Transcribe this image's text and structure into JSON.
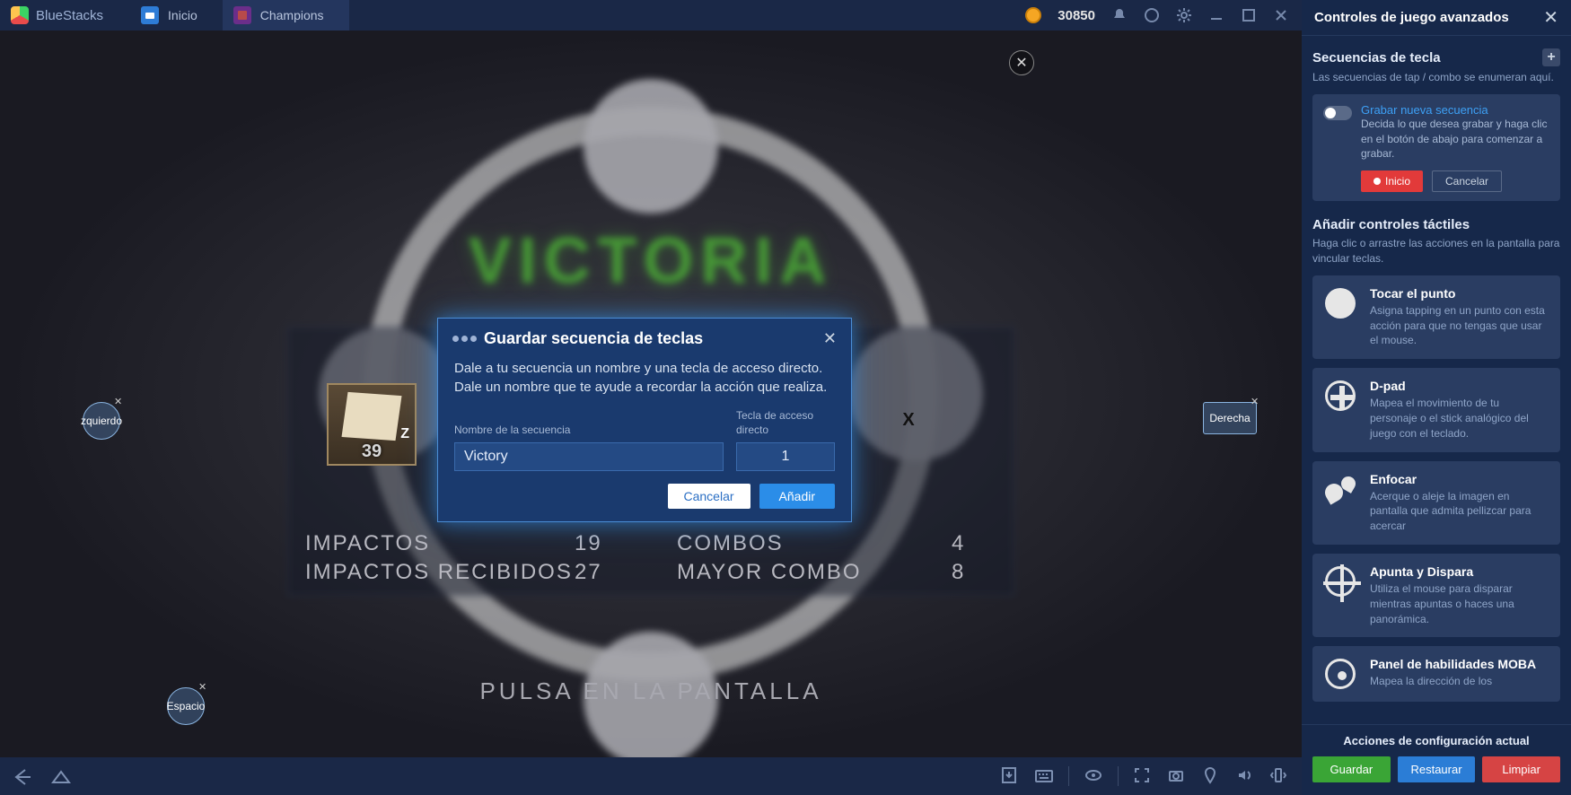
{
  "titlebar": {
    "brand": "BlueStacks",
    "tabs": [
      {
        "label": "Inicio"
      },
      {
        "label": "Champions"
      }
    ],
    "coins": "30850"
  },
  "game": {
    "victoria": "VICTORIA",
    "item_key": "Z",
    "item_count": "39",
    "stats": {
      "impactos_label": "IMPACTOS",
      "impactos_val": "19",
      "impactos_rec_label": "IMPACTOS RECIBIDOS",
      "impactos_rec_val": "27",
      "combos_label": "COMBOS",
      "combos_val": "4",
      "mayor_combo_label": "MAYOR COMBO",
      "mayor_combo_val": "8"
    },
    "pulsa": "PULSA EN LA PANTALLA",
    "overlays": {
      "izquierda": "zquierdo",
      "derecha": "Derecha",
      "espacio": "Espacio",
      "x": "X"
    }
  },
  "dialog": {
    "title": "Guardar secuencia de teclas",
    "desc": "Dale a tu secuencia un nombre y una tecla de acceso directo. Dale un nombre que te ayude a recordar la acción que realiza.",
    "name_label": "Nombre de la secuencia",
    "key_label": "Tecla de acceso directo",
    "name_value": "Victory",
    "key_value": "1",
    "cancel": "Cancelar",
    "add": "Añadir"
  },
  "panel": {
    "title": "Controles de juego avanzados",
    "seq_title": "Secuencias de tecla",
    "seq_sub": "Las secuencias de tap / combo se enumeran aquí.",
    "record": {
      "link": "Grabar nueva secuencia",
      "desc": "Decida lo que desea grabar y haga clic en el botón de abajo para comenzar a grabar.",
      "start": "Inicio",
      "cancel": "Cancelar"
    },
    "tactile_title": "Añadir controles táctiles",
    "tactile_sub": "Haga clic o arrastre las acciones en la pantalla para vincular teclas.",
    "controls": [
      {
        "title": "Tocar el punto",
        "desc": "Asigna tapping en un punto con esta acción para que no tengas que usar el mouse."
      },
      {
        "title": "D-pad",
        "desc": "Mapea el movimiento de tu personaje o el stick analógico del juego con el teclado."
      },
      {
        "title": "Enfocar",
        "desc": "Acerque o aleje la imagen en pantalla que admita pellizcar para acercar"
      },
      {
        "title": "Apunta y Dispara",
        "desc": "Utiliza el mouse para disparar mientras apuntas o haces una panorámica."
      },
      {
        "title": "Panel de habilidades MOBA",
        "desc": "Mapea la dirección de los"
      }
    ],
    "footer": {
      "title": "Acciones de configuración actual",
      "save": "Guardar",
      "restore": "Restaurar",
      "clear": "Limpiar"
    }
  }
}
